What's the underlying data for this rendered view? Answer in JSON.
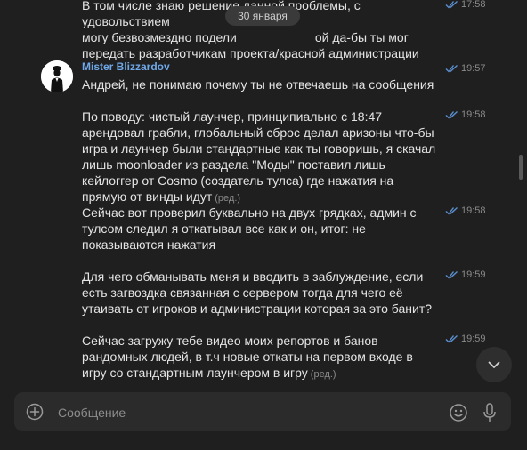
{
  "date_pill": "30 января",
  "top_message": {
    "line1": "В том числе знаю решение данной проблемы, с удовольствием",
    "line2": "могу безвозмездно подели",
    "line2_tail": "ой да-бы ты мог",
    "line3": "передать разработчикам проекта/красной администрации",
    "time": "17:58"
  },
  "author": {
    "name": "Mister Blizzardov"
  },
  "messages": [
    {
      "text": "Андрей, не понимаю почему ты не отвечаешь на сообщения",
      "time": "19:57",
      "edited": ""
    },
    {
      "text": "По поводу: чистый лаунчер, принципиально с 18:47 арендовал грабли, глобальный сброс делал аризоны что-бы игра и лаунчер были стандартные как ты говоришь, я скачал лишь moonloader из раздела \"Моды\" поставил лишь кейлоггер от Cosmo (создатель тулса) где нажатия на прямую от винды идут",
      "time": "19:58",
      "edited": "(ред.)"
    },
    {
      "text": "Сейчас вот проверил буквально на двух грядках, админ с тулсом следил я откатывал все как и он, итог: не показываются нажатия",
      "time": "19:58",
      "edited": ""
    },
    {
      "text": "Для чего обманывать меня и вводить в заблуждение, если есть загвоздка связанная с сервером тогда для чего её утаивать от игроков и администрации которая за это банит?",
      "time": "19:59",
      "edited": ""
    },
    {
      "text": "Сейчас загружу тебе видео моих репортов и банов рандомных людей, в т.ч новые откаты на первом входе в игру со стандартным лаунчером в игру",
      "time": "19:59",
      "edited": "(ред.)"
    }
  ],
  "composer": {
    "placeholder": "Сообщение"
  },
  "icons": {
    "avatar": "avatar-silhouette-icon",
    "read_checks": "double-check-icon",
    "scroll_down": "chevron-down-icon",
    "attach": "plus-circle-icon",
    "emoji": "smiley-icon",
    "voice": "microphone-icon"
  },
  "colors": {
    "background": "#1f1f1f",
    "author": "#6fa8e8",
    "read_check": "#5b8fd0",
    "meta": "#8a8a8a"
  }
}
